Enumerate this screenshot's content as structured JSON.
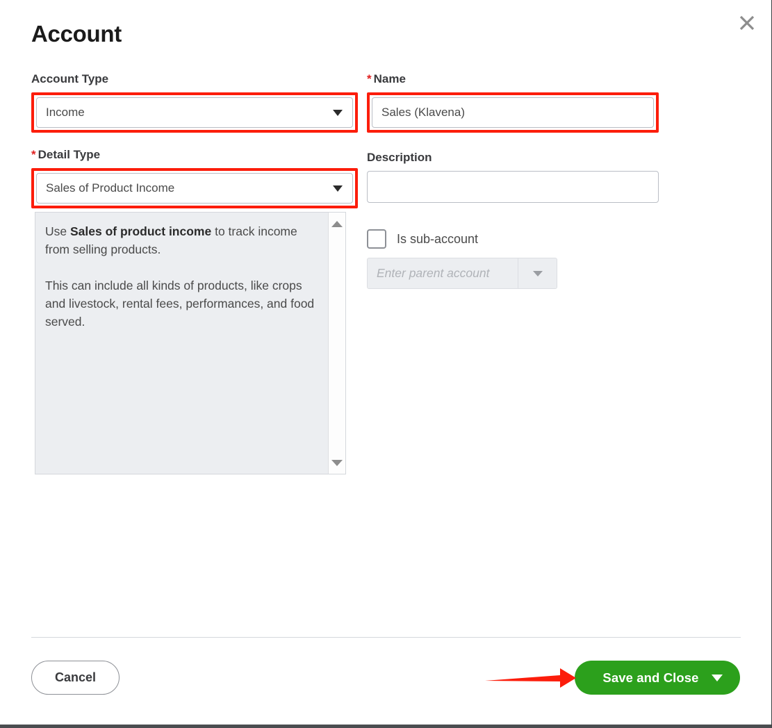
{
  "dialog": {
    "title": "Account",
    "close_icon": "close-icon"
  },
  "form": {
    "account_type": {
      "label": "Account Type",
      "required": false,
      "value": "Income",
      "highlighted": true
    },
    "detail_type": {
      "label": "Detail Type",
      "required": true,
      "required_marker": "*",
      "value": "Sales of Product Income",
      "highlighted": true
    },
    "name": {
      "label": "Name",
      "required": true,
      "required_marker": "*",
      "value": "Sales (Klavena)",
      "highlighted": true
    },
    "description": {
      "label": "Description",
      "required": false,
      "value": "",
      "placeholder": ""
    },
    "sub_account": {
      "checkbox_label": "Is sub-account",
      "checked": false,
      "parent_placeholder": "Enter parent account",
      "parent_value": "",
      "disabled": true
    }
  },
  "help_panel": {
    "paragraph1_prefix": "Use ",
    "paragraph1_bold": "Sales of product income",
    "paragraph1_suffix": " to track income from selling products.",
    "paragraph2": "This can include all kinds of products, like crops and livestock, rental fees, performances, and food served.",
    "scroll_up_icon": "scroll-up-arrow-icon",
    "scroll_down_icon": "scroll-down-arrow-icon"
  },
  "footer": {
    "cancel_label": "Cancel",
    "save_label": "Save and Close",
    "save_caret_icon": "chevron-down-icon"
  },
  "annotations": {
    "highlight_color": "#fc1d0b",
    "arrow_color": "#fc1d0b",
    "arrow_target": "save-and-close-button"
  },
  "colors": {
    "brand_green": "#2ca01c",
    "required_red": "#e02020",
    "panel_gray": "#eceef1",
    "border_gray": "#babec5",
    "text_dark": "#393a3d"
  }
}
